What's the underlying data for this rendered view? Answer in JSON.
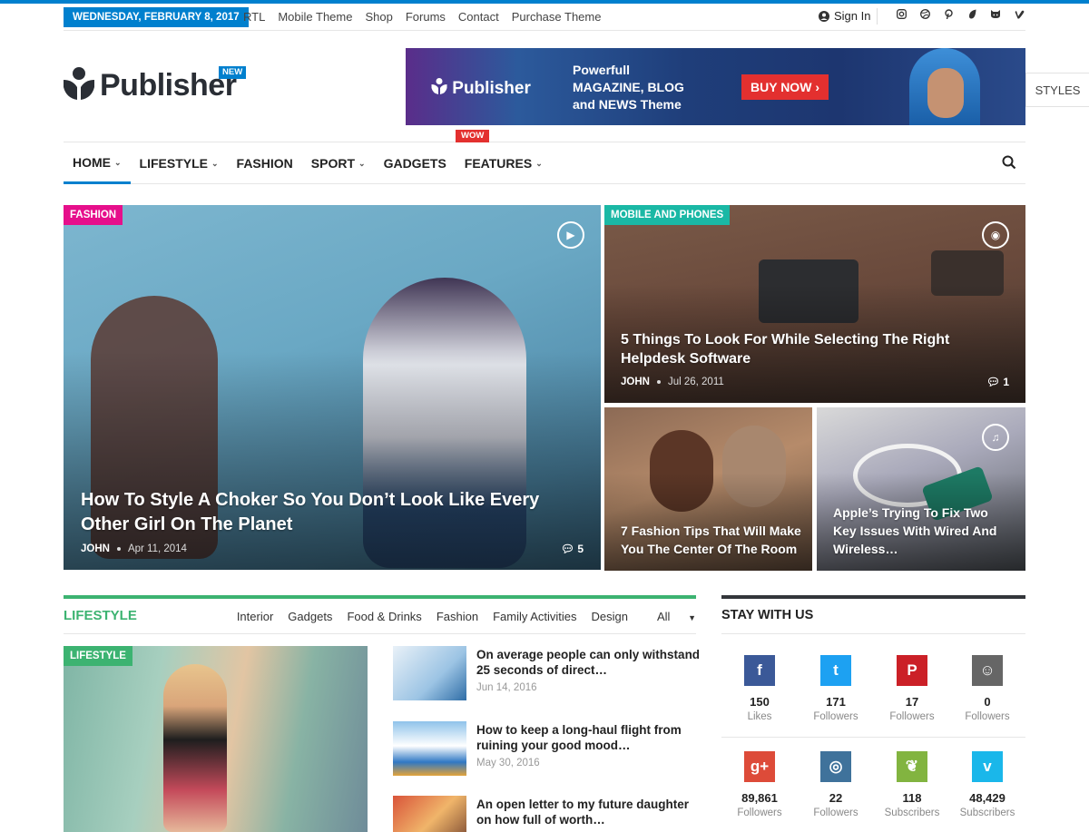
{
  "topbar": {
    "date": "WEDNESDAY, FEBRUARY 8, 2017",
    "links": [
      "RTL",
      "Mobile Theme",
      "Shop",
      "Forums",
      "Contact",
      "Purchase Theme"
    ],
    "signin": "Sign In",
    "social_icons": [
      "instagram-icon",
      "dribbble-icon",
      "pinterest-icon",
      "envato-icon",
      "github-icon",
      "vimeo-icon"
    ]
  },
  "header": {
    "logo_text": "Publisher",
    "logo_badge": "NEW",
    "banner": {
      "logo": "Publisher",
      "line1": "Powerfull",
      "line2": "MAGAZINE, BLOG",
      "line3": "and NEWS Theme",
      "button": "BUY NOW"
    },
    "styles_tab": "STYLES"
  },
  "nav": {
    "items": [
      {
        "label": "HOME",
        "dropdown": true
      },
      {
        "label": "LIFESTYLE",
        "dropdown": true
      },
      {
        "label": "FASHION",
        "dropdown": false
      },
      {
        "label": "SPORT",
        "dropdown": true
      },
      {
        "label": "GADGETS",
        "dropdown": false
      },
      {
        "label": "FEATURES",
        "dropdown": true
      }
    ],
    "badge": "WOW"
  },
  "hero": {
    "main": {
      "category": "FASHION",
      "title": "How To Style A Choker So You Don’t Look Like Every Other Girl On The Planet",
      "author": "JOHN",
      "date": "Apr 11, 2014",
      "comments": "5"
    },
    "top_right": {
      "category": "MOBILE AND PHONES",
      "title": "5 Things To Look For While Selecting The Right Helpdesk Software",
      "author": "JOHN",
      "date": "Jul 26, 2011",
      "comments": "1"
    },
    "bottom_left": {
      "title": "7 Fashion Tips That Will Make You The Center Of The Room"
    },
    "bottom_right": {
      "title": "Apple’s Trying To Fix Two Key Issues With Wired And Wireless…"
    }
  },
  "lifestyle": {
    "title": "LIFESTYLE",
    "tabs": [
      "Interior",
      "Gadgets",
      "Food & Drinks",
      "Fashion",
      "Family Activities",
      "Design",
      "All"
    ],
    "featured_category": "LIFESTYLE",
    "posts": [
      {
        "title": "On average people can only withstand 25 seconds of direct…",
        "date": "Jun 14, 2016"
      },
      {
        "title": "How to keep a long-haul flight from ruining your good mood…",
        "date": "May 30, 2016"
      },
      {
        "title": "An open letter to my future daughter on how full of worth…",
        "date": ""
      }
    ]
  },
  "stay": {
    "title": "STAY WITH US",
    "networks": [
      {
        "name": "facebook-icon",
        "glyph": "f",
        "count": "150",
        "label": "Likes",
        "color": "#3b5998"
      },
      {
        "name": "twitter-icon",
        "glyph": "t",
        "count": "171",
        "label": "Followers",
        "color": "#1da1f2"
      },
      {
        "name": "pinterest-icon",
        "glyph": "P",
        "count": "17",
        "label": "Followers",
        "color": "#cb2027"
      },
      {
        "name": "github-icon",
        "glyph": "☺",
        "count": "0",
        "label": "Followers",
        "color": "#666666"
      },
      {
        "name": "google-plus-icon",
        "glyph": "g+",
        "count": "89,861",
        "label": "Followers",
        "color": "#dd4b39"
      },
      {
        "name": "instagram-icon",
        "glyph": "◎",
        "count": "22",
        "label": "Followers",
        "color": "#3f729b"
      },
      {
        "name": "envato-icon",
        "glyph": "❦",
        "count": "118",
        "label": "Subscribers",
        "color": "#82b440"
      },
      {
        "name": "vimeo-icon",
        "glyph": "v",
        "count": "48,429",
        "label": "Subscribers",
        "color": "#1ab7ea"
      }
    ]
  }
}
